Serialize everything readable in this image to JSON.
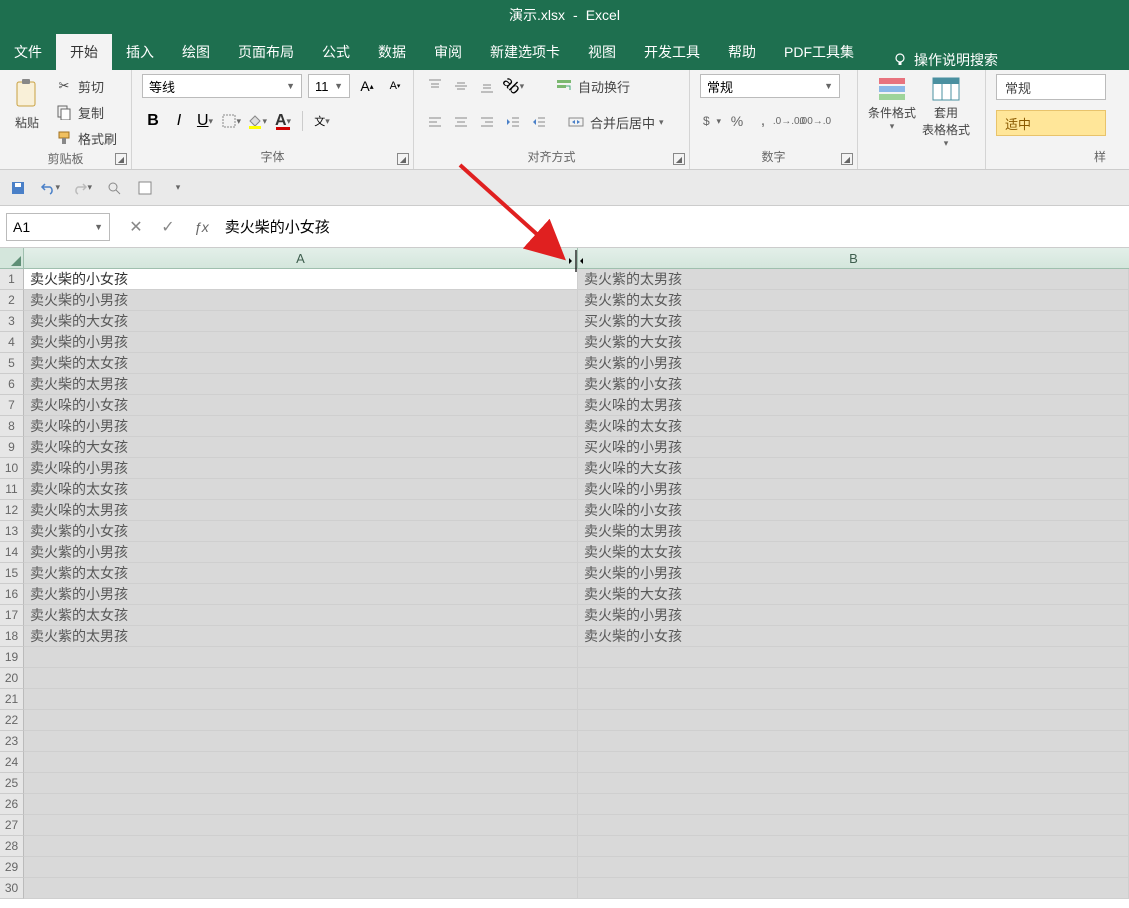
{
  "title": {
    "filename": "演示.xlsx",
    "dash": "-",
    "app": "Excel"
  },
  "tabs": [
    "文件",
    "开始",
    "插入",
    "绘图",
    "页面布局",
    "公式",
    "数据",
    "审阅",
    "新建选项卡",
    "视图",
    "开发工具",
    "帮助",
    "PDF工具集"
  ],
  "active_tab_index": 1,
  "tell_me": "操作说明搜索",
  "clipboard": {
    "paste": "粘贴",
    "cut": "剪切",
    "copy": "复制",
    "format_painter": "格式刷",
    "group_label": "剪贴板"
  },
  "font": {
    "name": "等线",
    "size": "11",
    "group_label": "字体"
  },
  "alignment": {
    "wrap_text": "自动换行",
    "merge_center": "合并后居中",
    "group_label": "对齐方式"
  },
  "number": {
    "format": "常规",
    "group_label": "数字"
  },
  "styles": {
    "cond_format": "条件格式",
    "table_format_1": "套用",
    "table_format_2": "表格格式",
    "style_normal": "常规",
    "style_moderate": "适中",
    "group_label_fragment": "样"
  },
  "formula_bar": {
    "cell_ref": "A1",
    "value": "卖火柴的小女孩"
  },
  "columns": [
    "A",
    "B"
  ],
  "cells": {
    "A": [
      "卖火柴的小女孩",
      "卖火柴的小男孩",
      "卖火柴的大女孩",
      "卖火柴的小男孩",
      "卖火柴的太女孩",
      "卖火柴的太男孩",
      "卖火哚的小女孩",
      "卖火哚的小男孩",
      "卖火哚的大女孩",
      "卖火哚的小男孩",
      "卖火哚的太女孩",
      "卖火哚的太男孩",
      "卖火紫的小女孩",
      "卖火紫的小男孩",
      "卖火紫的太女孩",
      "卖火紫的小男孩",
      "卖火紫的太女孩",
      "卖火紫的太男孩"
    ],
    "B": [
      "卖火紫的太男孩",
      "卖火紫的太女孩",
      "买火紫的大女孩",
      "卖火紫的大女孩",
      "卖火紫的小男孩",
      "卖火紫的小女孩",
      "卖火哚的太男孩",
      "卖火哚的太女孩",
      "买火哚的小男孩",
      "卖火哚的大女孩",
      "卖火哚的小男孩",
      "卖火哚的小女孩",
      "卖火柴的太男孩",
      "卖火柴的太女孩",
      "卖火柴的小男孩",
      "卖火柴的大女孩",
      "卖火柴的小男孩",
      "卖火柴的小女孩"
    ]
  },
  "total_visible_rows": 30
}
